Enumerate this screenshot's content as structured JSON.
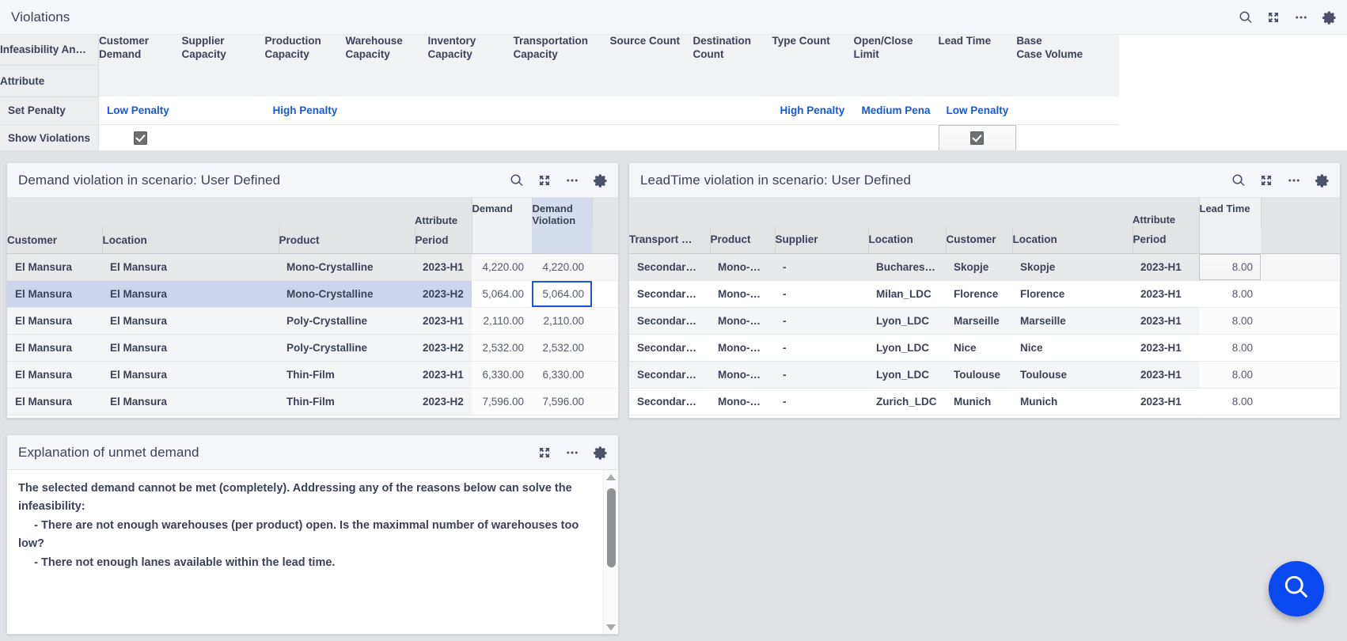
{
  "violations": {
    "title": "Violations",
    "icons": [
      "search-icon",
      "expand-icon",
      "more-icon",
      "gear-icon"
    ],
    "corner_label_1": "Infeasibility An…",
    "corner_label_2": "Attribute",
    "columns": [
      "Customer Demand",
      "Supplier Capacity",
      "Production Capacity",
      "Warehouse Capacity",
      "Inventory Capacity",
      "Transportation Capacity",
      "Source Count",
      "Destination Count",
      "Type Count",
      "Open/Close Limit",
      "Lead Time",
      "Base Case Volume"
    ],
    "rows": [
      {
        "label": "Set Penalty",
        "values": [
          "Low Penalty",
          "",
          "High Penalty",
          "",
          "",
          "",
          "",
          "",
          "High Penalty",
          "Medium Pena",
          "Low Penalty",
          ""
        ]
      },
      {
        "label": "Show Violations",
        "values": [
          "checked",
          "",
          "",
          "",
          "",
          "",
          "",
          "",
          "",
          "",
          "checked-selected",
          ""
        ]
      }
    ]
  },
  "demand_panel": {
    "title": "Demand violation in scenario: User Defined",
    "icons": [
      "search-icon",
      "expand-icon",
      "more-icon",
      "gear-icon"
    ],
    "attribute_header": "Attribute",
    "measure_headers": [
      "Demand",
      "Demand Violation"
    ],
    "columns": [
      "Customer",
      "Location",
      "Product",
      "Period"
    ],
    "rows": [
      {
        "cells": [
          "El Mansura",
          "El Mansura",
          "Mono-Crystalline",
          "2023-H1"
        ],
        "demand": "4,220.00",
        "violation": "4,220.00",
        "state": "first"
      },
      {
        "cells": [
          "El Mansura",
          "El Mansura",
          "Mono-Crystalline",
          "2023-H2"
        ],
        "demand": "5,064.00",
        "violation": "5,064.00",
        "state": "selected"
      },
      {
        "cells": [
          "El Mansura",
          "El Mansura",
          "Poly-Crystalline",
          "2023-H1"
        ],
        "demand": "2,110.00",
        "violation": "2,110.00",
        "state": "alt"
      },
      {
        "cells": [
          "El Mansura",
          "El Mansura",
          "Poly-Crystalline",
          "2023-H2"
        ],
        "demand": "2,532.00",
        "violation": "2,532.00",
        "state": "alt"
      },
      {
        "cells": [
          "El Mansura",
          "El Mansura",
          "Thin-Film",
          "2023-H1"
        ],
        "demand": "6,330.00",
        "violation": "6,330.00",
        "state": "alt"
      },
      {
        "cells": [
          "El Mansura",
          "El Mansura",
          "Thin-Film",
          "2023-H2"
        ],
        "demand": "7,596.00",
        "violation": "7,596.00",
        "state": "alt"
      }
    ]
  },
  "leadtime_panel": {
    "title": "LeadTime violation in scenario: User Defined",
    "icons": [
      "search-icon",
      "expand-icon",
      "more-icon",
      "gear-icon"
    ],
    "attribute_header": "Attribute",
    "measure_headers": [
      "Lead Time"
    ],
    "columns": [
      "Transport …",
      "Product",
      "Supplier",
      "Location",
      "Customer",
      "Location",
      "Period"
    ],
    "rows": [
      {
        "cells": [
          "Secondary…",
          "Mono-Cry…",
          "-",
          "Bucharest…",
          "Skopje",
          "Skopje",
          "2023-H1"
        ],
        "lead_time": "8.00",
        "state": "first"
      },
      {
        "cells": [
          "Secondary…",
          "Mono-Cry…",
          "-",
          "Milan_LDC",
          "Florence",
          "Florence",
          "2023-H1"
        ],
        "lead_time": "8.00",
        "state": "plain"
      },
      {
        "cells": [
          "Secondary…",
          "Mono-Cry…",
          "-",
          "Lyon_LDC",
          "Marseille",
          "Marseille",
          "2023-H1"
        ],
        "lead_time": "8.00",
        "state": "alt"
      },
      {
        "cells": [
          "Secondary…",
          "Mono-Cry…",
          "-",
          "Lyon_LDC",
          "Nice",
          "Nice",
          "2023-H1"
        ],
        "lead_time": "8.00",
        "state": "plain"
      },
      {
        "cells": [
          "Secondary…",
          "Mono-Cry…",
          "-",
          "Lyon_LDC",
          "Toulouse",
          "Toulouse",
          "2023-H1"
        ],
        "lead_time": "8.00",
        "state": "alt"
      },
      {
        "cells": [
          "Secondary…",
          "Mono-Cry…",
          "-",
          "Zurich_LDC",
          "Munich",
          "Munich",
          "2023-H1"
        ],
        "lead_time": "8.00",
        "state": "plain"
      }
    ]
  },
  "explain_panel": {
    "title": "Explanation of unmet demand",
    "icons": [
      "expand-icon",
      "more-icon",
      "gear-icon"
    ],
    "text": "The selected demand cannot be met (completely). Addressing any of the reasons below can solve the infeasibility:\n     - There are not enough warehouses (per product) open. Is the maximmal number of warehouses too low?\n     - There not enough lanes available within the lead time."
  },
  "fab": {
    "icon": "search-icon"
  },
  "colors": {
    "link": "#1558e8",
    "accent": "#0a48f0",
    "selection_row": "#ccd5ec",
    "selection_cell_border": "#1a56d6",
    "measure_header": "#f0f1f3",
    "measure_header_selected": "#d5dcee"
  }
}
